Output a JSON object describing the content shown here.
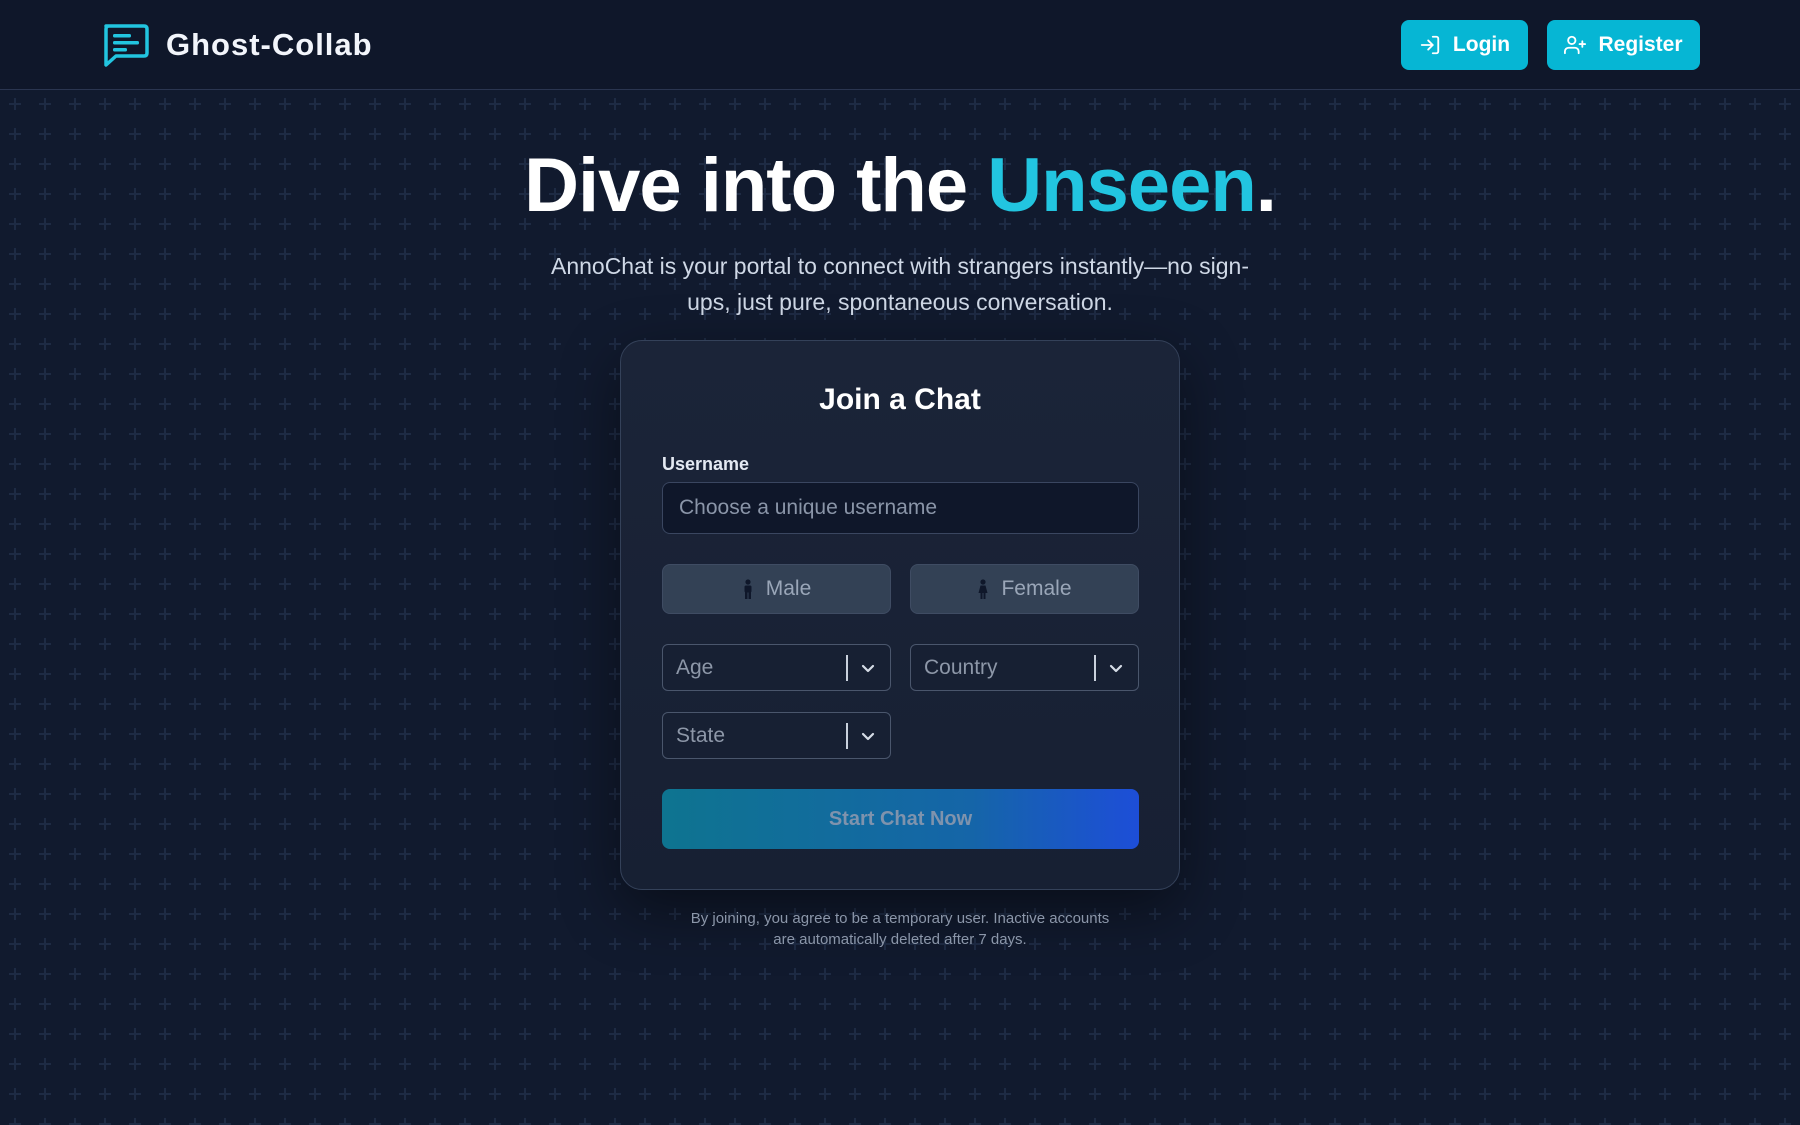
{
  "header": {
    "brand_name": "Ghost-Collab",
    "login_label": "Login",
    "register_label": "Register"
  },
  "hero": {
    "title_prefix": "Dive into the ",
    "title_accent": "Unseen",
    "title_suffix": ".",
    "subtitle": "AnnoChat is your portal to connect with strangers instantly—no sign-ups, just pure, spontaneous conversation."
  },
  "form": {
    "title": "Join a Chat",
    "username_label": "Username",
    "username_placeholder": "Choose a unique username",
    "username_value": "",
    "gender_male": "Male",
    "gender_female": "Female",
    "age_placeholder": "Age",
    "country_placeholder": "Country",
    "state_placeholder": "State",
    "submit_label": "Start Chat Now"
  },
  "footer": {
    "disclaimer": "By joining, you agree to be a temporary user. Inactive accounts are automatically deleted after 7 days."
  },
  "colors": {
    "background": "#0f172a",
    "accent": "#06b6d4",
    "accent_text": "#22c5e0",
    "card": "#1b2438"
  },
  "icons": {
    "brand": "chat-bubble-icon",
    "login": "log-in-icon",
    "register": "user-plus-icon",
    "male": "male-person-icon",
    "female": "female-person-icon",
    "dropdown": "chevron-down-icon"
  }
}
